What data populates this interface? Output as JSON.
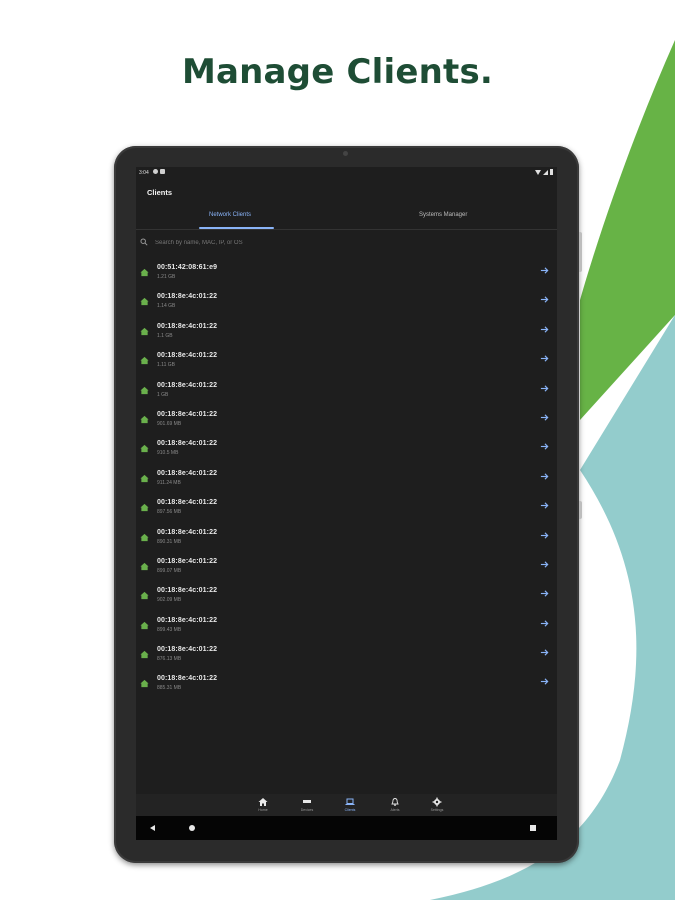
{
  "headline": "Manage Clients.",
  "colors": {
    "headline": "#1e4d35",
    "brand_green": "#67b346",
    "teal": "#93cccc",
    "accent_blue": "#8ab4f8",
    "client_icon_green": "#6ab04c"
  },
  "status_bar": {
    "time": "3:04"
  },
  "app": {
    "title": "Clients",
    "tabs": [
      {
        "label": "Network Clients",
        "active": true
      },
      {
        "label": "Systems Manager",
        "active": false
      }
    ],
    "search": {
      "placeholder": "Search by name, MAC, IP, or OS",
      "value": ""
    },
    "clients": [
      {
        "name": "00:51:42:08:61:e9",
        "usage": "1.21 GB",
        "icon": "house-icon"
      },
      {
        "name": "00:18:8e:4c:01:22",
        "usage": "1.14 GB",
        "icon": "house-icon"
      },
      {
        "name": "00:18:8e:4c:01:22",
        "usage": "1.1 GB",
        "icon": "house-icon"
      },
      {
        "name": "00:18:8e:4c:01:22",
        "usage": "1.11 GB",
        "icon": "house-icon"
      },
      {
        "name": "00:18:8e:4c:01:22",
        "usage": "1 GB",
        "icon": "house-icon"
      },
      {
        "name": "00:18:8e:4c:01:22",
        "usage": "901.69 MB",
        "icon": "house-icon"
      },
      {
        "name": "00:18:8e:4c:01:22",
        "usage": "910.5 MB",
        "icon": "house-icon"
      },
      {
        "name": "00:18:8e:4c:01:22",
        "usage": "911.24 MB",
        "icon": "house-icon"
      },
      {
        "name": "00:18:8e:4c:01:22",
        "usage": "897.56 MB",
        "icon": "house-icon"
      },
      {
        "name": "00:18:8e:4c:01:22",
        "usage": "890.31 MB",
        "icon": "house-icon"
      },
      {
        "name": "00:18:8e:4c:01:22",
        "usage": "899.07 MB",
        "icon": "house-icon"
      },
      {
        "name": "00:18:8e:4c:01:22",
        "usage": "902.09 MB",
        "icon": "house-icon"
      },
      {
        "name": "00:18:8e:4c:01:22",
        "usage": "899.43 MB",
        "icon": "house-icon"
      },
      {
        "name": "00:18:8e:4c:01:22",
        "usage": "876.13 MB",
        "icon": "house-icon"
      },
      {
        "name": "00:18:8e:4c:01:22",
        "usage": "885.31 MB",
        "icon": "house-icon"
      }
    ],
    "bottom_nav": [
      {
        "label": "Home",
        "icon": "home-icon",
        "active": false
      },
      {
        "label": "Devices",
        "icon": "devices-icon",
        "active": false
      },
      {
        "label": "Clients",
        "icon": "laptop-icon",
        "active": true
      },
      {
        "label": "Alerts",
        "icon": "bell-icon",
        "active": false
      },
      {
        "label": "Settings",
        "icon": "gear-icon",
        "active": false
      }
    ]
  }
}
